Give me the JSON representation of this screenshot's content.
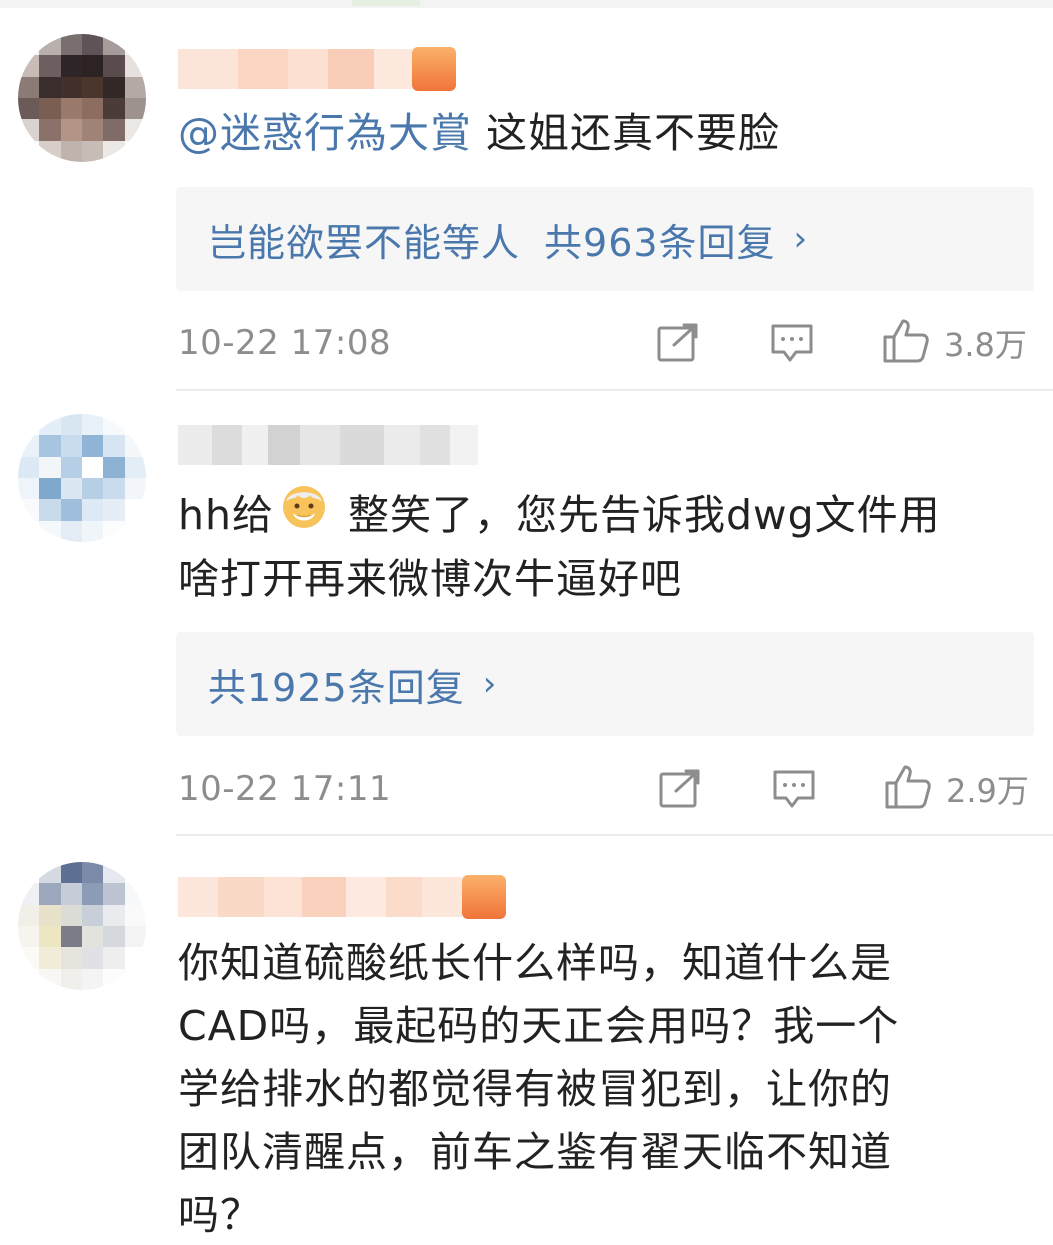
{
  "comments": [
    {
      "mention": "@迷惑行為大賞",
      "text": " 这姐还真不要脸",
      "reply_quote": "岂能欲罢不能等人",
      "reply_count": "共963条回复",
      "time": "10-22 17:08",
      "likes": "3.8万"
    },
    {
      "text_line1_prefix": "hh给",
      "text_line1_suffix": " 整笑了，您先告诉我dwg文件用",
      "text_line2": "啥打开再来微博次牛逼好吧",
      "emoji": "old-man-emoji",
      "reply_count": "共1925条回复",
      "time": "10-22 17:11",
      "likes": "2.9万"
    },
    {
      "lines": [
        "你知道硫酸纸长什么样吗，知道什么是",
        "CAD吗，最起码的天正会用吗？我一个",
        "学给排水的都觉得有被冒犯到，让你的",
        "团队清醒点，前车之鉴有翟天临不知道",
        "吗？"
      ]
    }
  ],
  "icons": {
    "share": "share-icon",
    "comment": "comment-icon",
    "like": "thumbs-up-icon",
    "reply_arrow": "chevron-right-icon"
  },
  "colors": {
    "link": "#4a78ad",
    "meta": "#8d8d8d",
    "reply_bg": "#f6f6f6"
  }
}
